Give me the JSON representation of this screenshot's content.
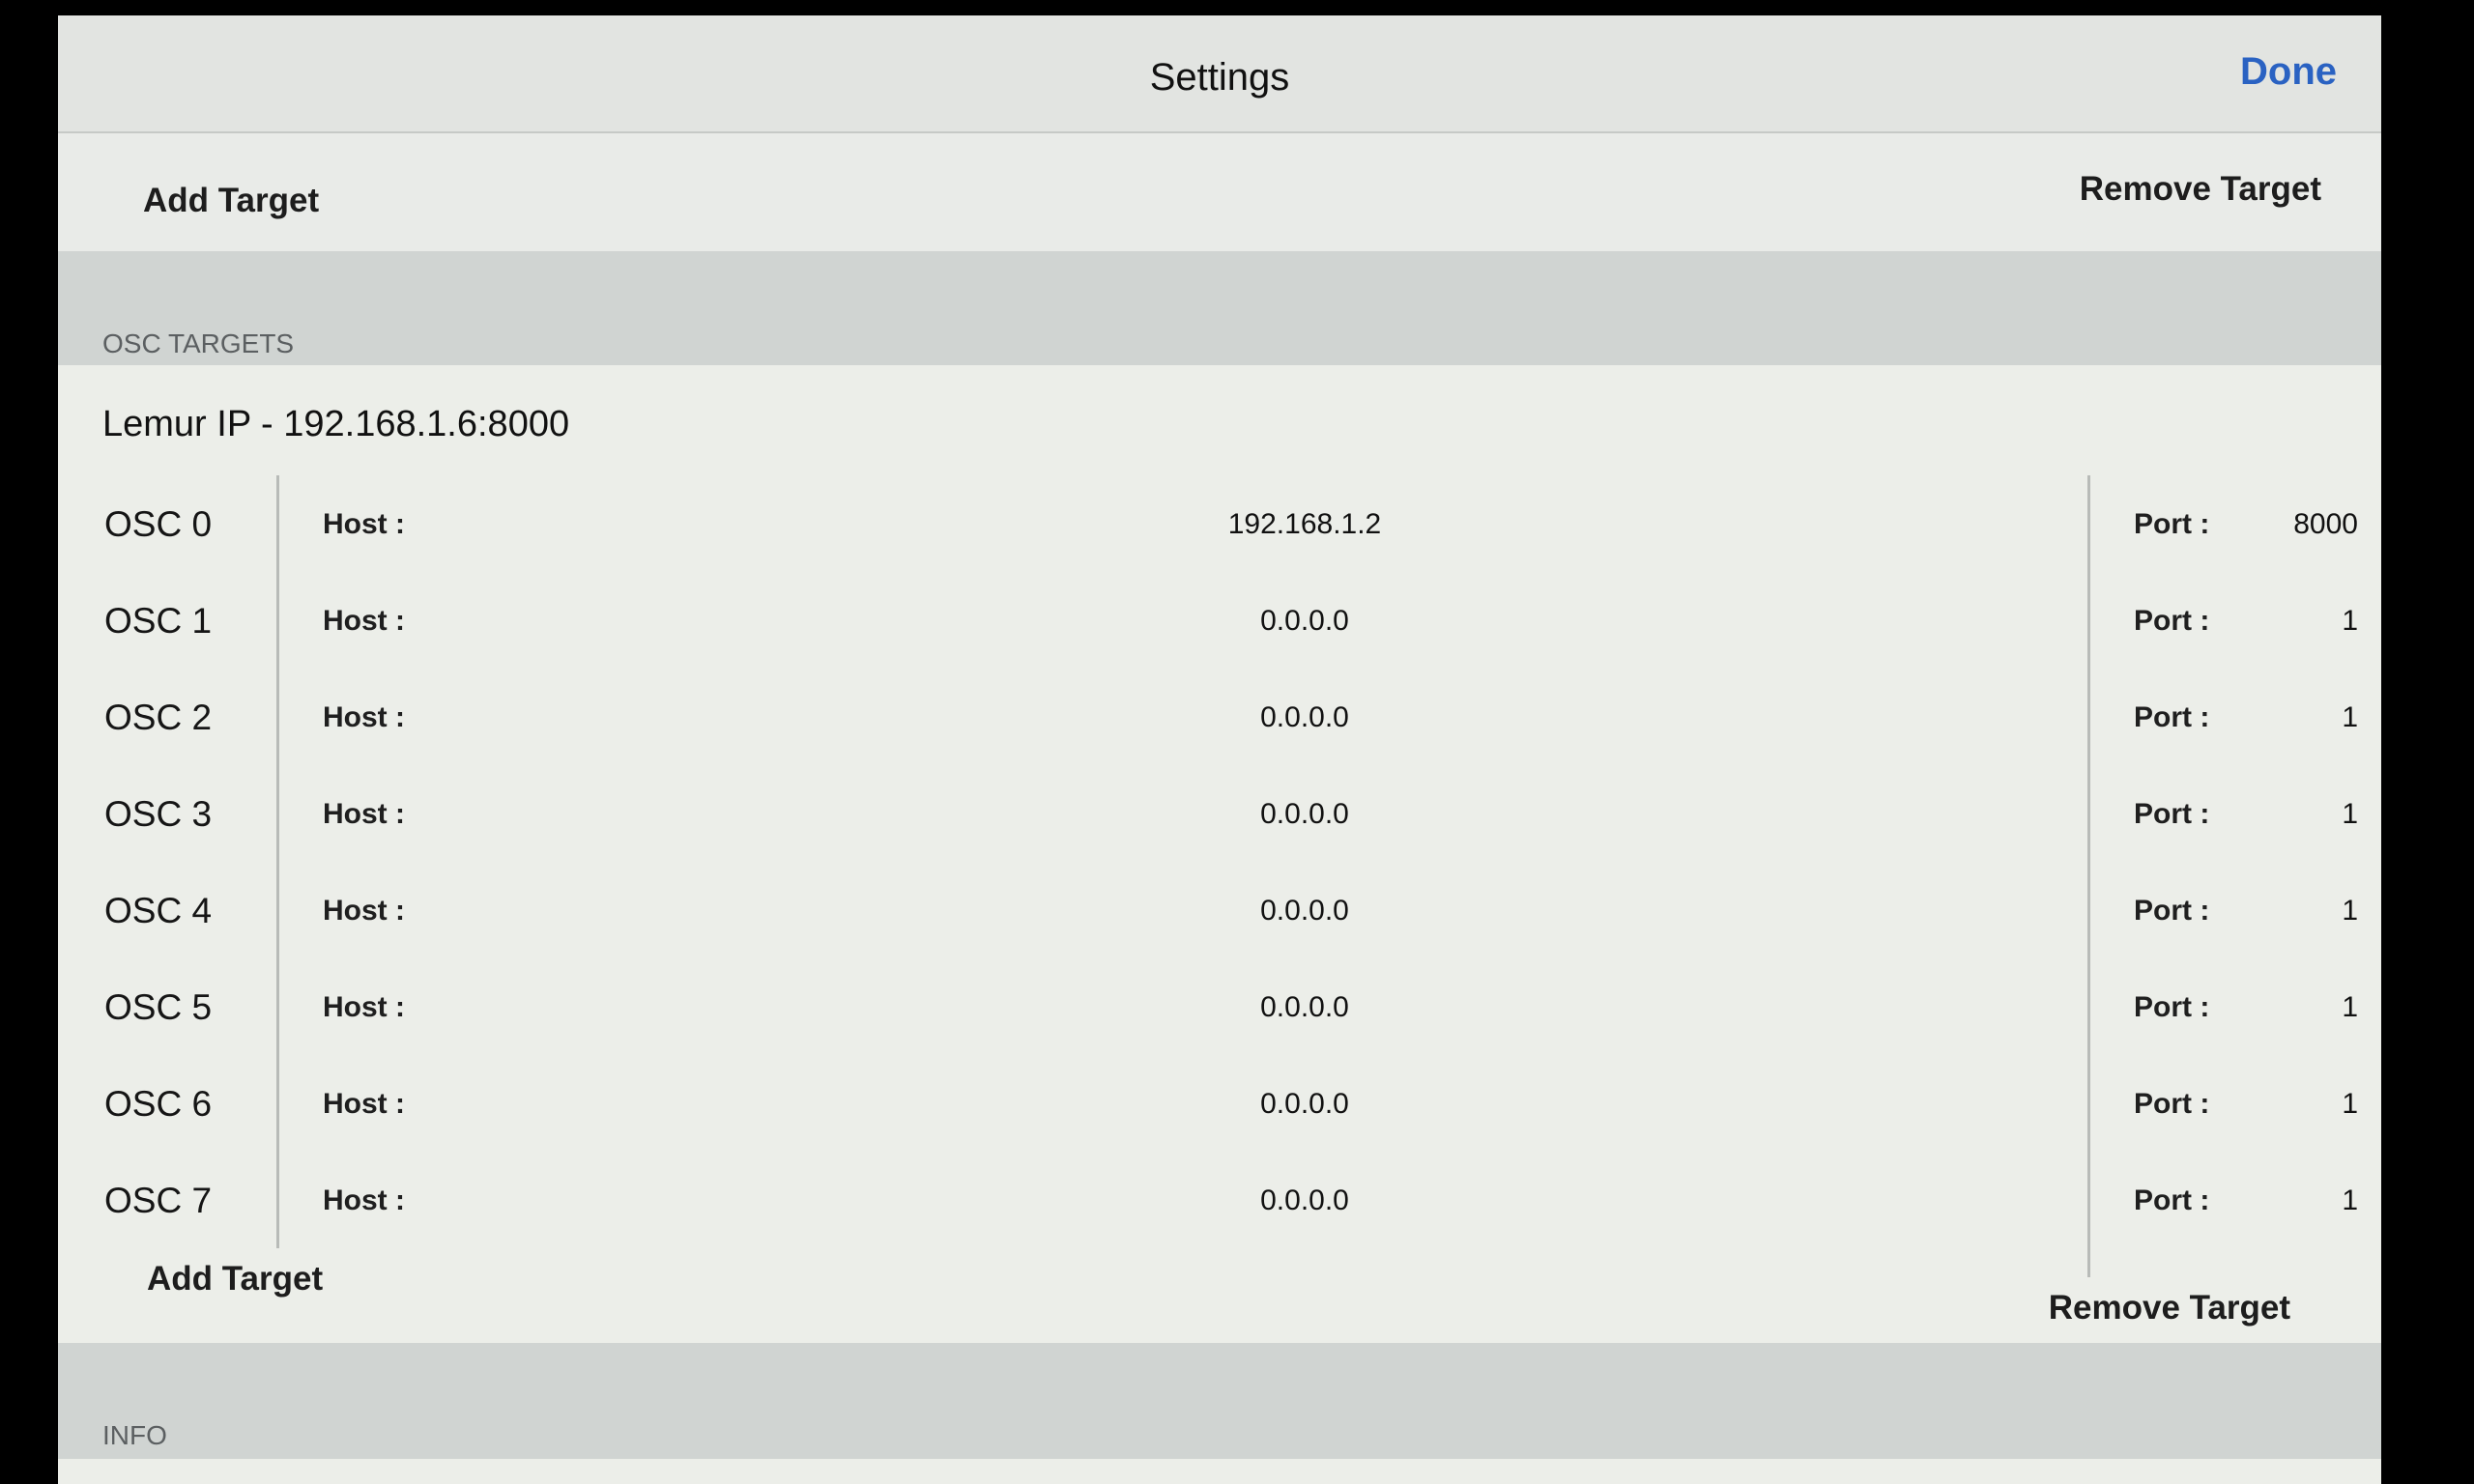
{
  "nav": {
    "title": "Settings",
    "done_label": "Done"
  },
  "actions": {
    "add_target": "Add Target",
    "remove_target": "Remove Target"
  },
  "sections": {
    "osc_targets": "OSC TARGETS",
    "info": "INFO"
  },
  "target": {
    "title": "Lemur IP - 192.168.1.6:8000",
    "host_label": "Host :",
    "port_label": "Port :",
    "rows": [
      {
        "name": "OSC 0",
        "host": "192.168.1.2",
        "port": "8000"
      },
      {
        "name": "OSC 1",
        "host": "0.0.0.0",
        "port": "1"
      },
      {
        "name": "OSC 2",
        "host": "0.0.0.0",
        "port": "1"
      },
      {
        "name": "OSC 3",
        "host": "0.0.0.0",
        "port": "1"
      },
      {
        "name": "OSC 4",
        "host": "0.0.0.0",
        "port": "1"
      },
      {
        "name": "OSC 5",
        "host": "0.0.0.0",
        "port": "1"
      },
      {
        "name": "OSC 6",
        "host": "0.0.0.0",
        "port": "1"
      },
      {
        "name": "OSC 7",
        "host": "0.0.0.0",
        "port": "1"
      }
    ]
  }
}
